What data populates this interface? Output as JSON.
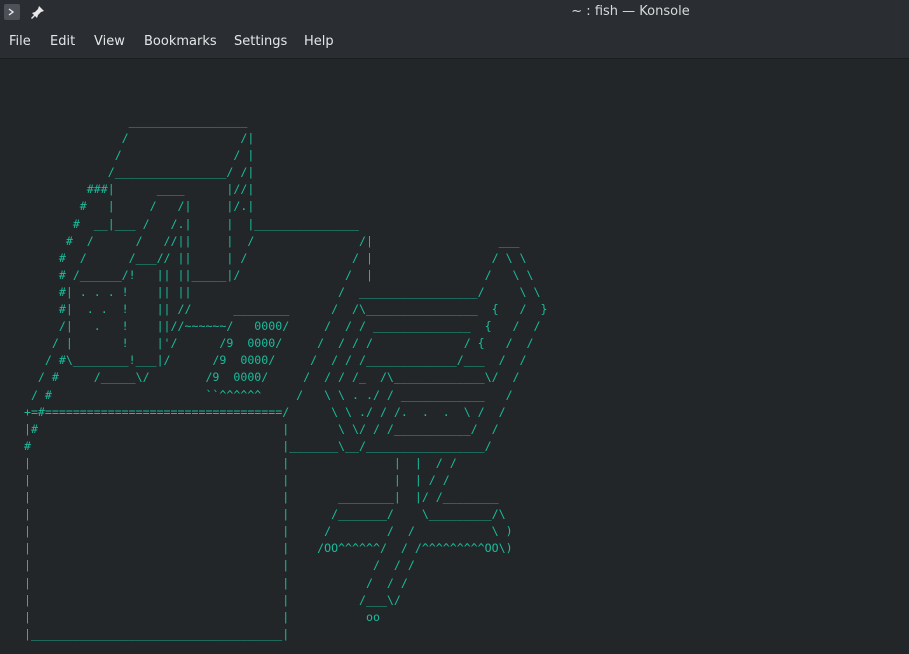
{
  "window": {
    "title": "~ : fish — Konsole",
    "app_icon": "konsole-icon",
    "pin_icon": "pin-icon"
  },
  "menu": {
    "file": "File",
    "edit": "Edit",
    "view": "View",
    "bookmarks": "Bookmarks",
    "settings": "Settings",
    "help": "Help"
  },
  "terminal": {
    "art": "                 _________________\n                /                /|\n               /                / |\n              /________________/ /|\n           ###|      ____      |//|\n          #   |     /   /|     |/.|\n         #  __|___ /   /.|     |  |_______________\n        #  /      /   //||     |  /               /|                  ___\n       #  /      /___// ||     | /               / |                 / \\ \\\n       # /______/!   || ||_____|/               /  |                /   \\ \\\n       #| . . . !    || ||                     /  _________________/     \\ \\\n       #|  . .  !    || //      ________      /  /\\________________  {   /  }\n       /|   .   !    ||//~~~~~~/   0000/     /  / / ______________  {   /  /\n      / |       !    |'/      /9  0000/     /  / / /             / {   /  /\n     / #\\________!___|/      /9  0000/     /  / / /_____________/___  /  /\n    / #     /_____\\/        /9  0000/     /  / / /_  /\\_____________\\/  /\n   / #                      ``^^^^^^     /   \\ \\ . ./ / ____________   /\n  +=#==================================/      \\ \\ ./ / /.  .  .  \\ /  /\n  |#                                   |       \\ \\/ / /___________/  /\n  #                                    |_______\\__/_________________/\n  |                                    |               |  |  / /\n  |                                    |               |  | / /\n  |                                    |       ________|  |/ /________\n  |                                    |      /_______/    \\_________/\\\n  |                                    |     /        /  /           \\ )\n  |                                    |    /OO^^^^^^/  / /^^^^^^^^^OO\\)\n  |                                    |            /  / /\n  |                                    |           /  / /\n  |                                    |          /___\\/\n  |                                    |           oo\n  |____________________________________|"
  }
}
